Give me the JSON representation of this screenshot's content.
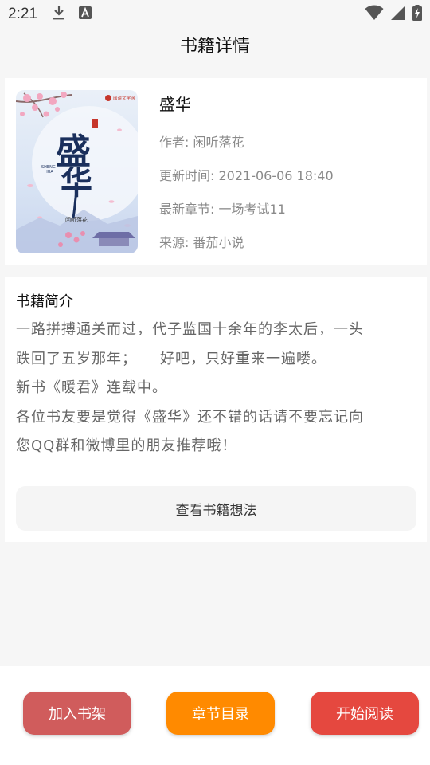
{
  "status_bar": {
    "time": "2:21",
    "icons": [
      "download-icon",
      "font-a-icon",
      "wifi-icon",
      "cell-signal-icon",
      "battery-charging-icon"
    ]
  },
  "app_bar": {
    "title": "书籍详情"
  },
  "book": {
    "title": "盛华",
    "author": "作者: 闲听落花",
    "updated": "更新时间: 2021-06-06 18:40",
    "latest_chapter": "最新章节: 一场考试11",
    "source": "来源: 番茄小说",
    "cover": {
      "calligraphy": "盛华",
      "author_caption": "闲听落花",
      "pinyin": "SHENG HUA",
      "publisher": "阅读文学网"
    }
  },
  "intro": {
    "heading": "书籍简介",
    "lines": [
      "一路拼搏通关而过，代子监国十余年的李太后，一头",
      "跌回了五岁那年；　　好吧，只好重来一遍喽。",
      "新书《暖君》连载中。",
      "各位书友要是觉得《盛华》还不错的话请不要忘记向",
      "您QQ群和微博里的朋友推荐哦！"
    ],
    "thoughts_button": "查看书籍想法"
  },
  "actions": {
    "add_shelf": "加入书架",
    "toc": "章节目录",
    "start_reading": "开始阅读",
    "colors": {
      "add_shelf": "#d05c5c",
      "toc": "#ff8a00",
      "start_reading": "#e5483f"
    }
  }
}
